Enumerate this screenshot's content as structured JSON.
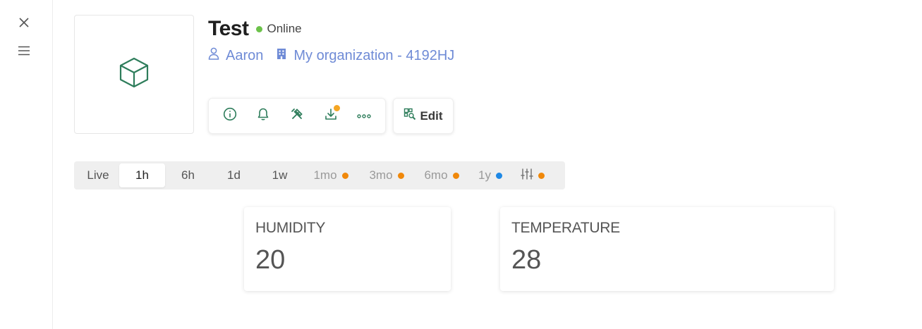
{
  "device": {
    "name": "Test",
    "status": "Online",
    "status_color": "#6cc24a",
    "owner": "Aaron",
    "organization": "My organization - 4192HJ",
    "icon": "cube-icon",
    "accent_color": "#2e7d5b"
  },
  "actions": [
    {
      "name": "info-icon"
    },
    {
      "name": "bell-icon"
    },
    {
      "name": "tools-icon"
    },
    {
      "name": "download-icon",
      "badge_color": "#f5a623"
    },
    {
      "name": "more-icon"
    }
  ],
  "edit_label": "Edit",
  "time_ranges": [
    {
      "label": "Live",
      "active": false,
      "dim": false
    },
    {
      "label": "1h",
      "active": true,
      "dim": false
    },
    {
      "label": "6h",
      "active": false,
      "dim": false
    },
    {
      "label": "1d",
      "active": false,
      "dim": false
    },
    {
      "label": "1w",
      "active": false,
      "dim": false
    },
    {
      "label": "1mo",
      "active": false,
      "dim": true,
      "dot_color": "#f0880a"
    },
    {
      "label": "3mo",
      "active": false,
      "dim": true,
      "dot_color": "#f0880a"
    },
    {
      "label": "6mo",
      "active": false,
      "dim": true,
      "dot_color": "#f0880a"
    },
    {
      "label": "1y",
      "active": false,
      "dim": true,
      "dot_color": "#1e88e5"
    },
    {
      "label": "",
      "icon": "sliders-icon",
      "active": false,
      "dim": true,
      "dot_color": "#f0880a"
    }
  ],
  "widgets": [
    {
      "label": "HUMIDITY",
      "value": "20"
    },
    {
      "label": "TEMPERATURE",
      "value": "28"
    }
  ]
}
